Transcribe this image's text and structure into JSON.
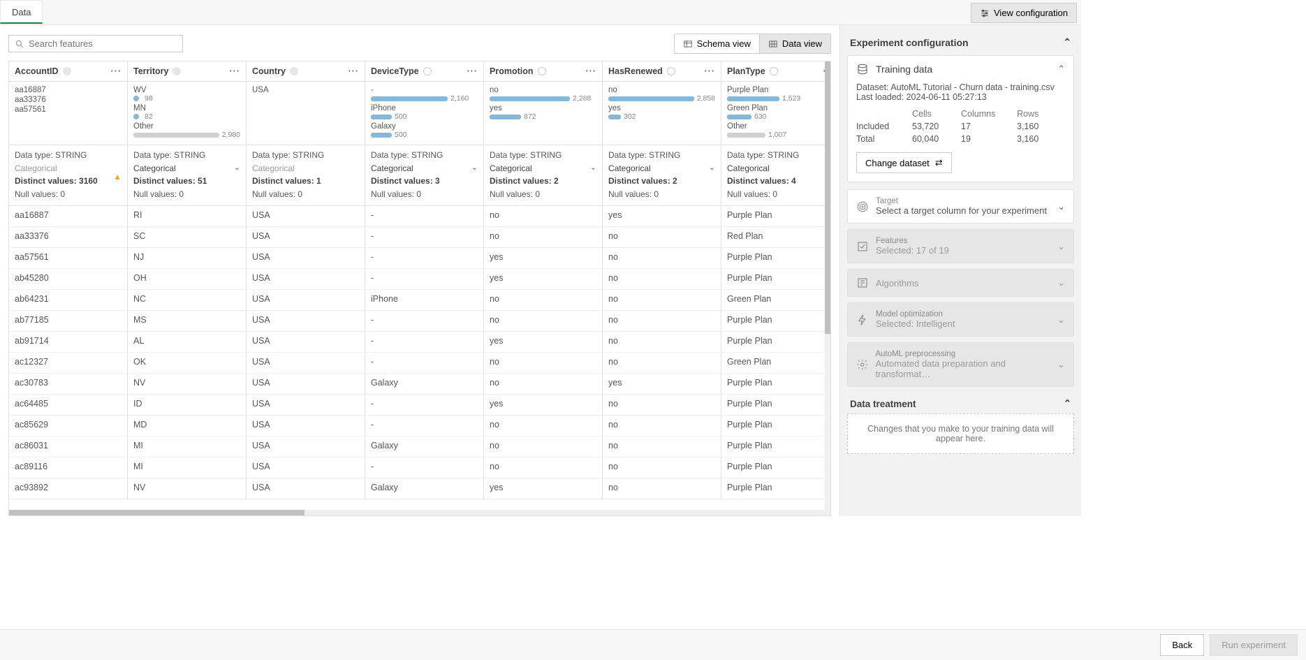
{
  "topbar": {
    "tab_label": "Data",
    "view_config_label": "View configuration"
  },
  "toolbar": {
    "search_placeholder": "Search features",
    "schema_view_label": "Schema view",
    "data_view_label": "Data view"
  },
  "columns": [
    {
      "name": "AccountID",
      "indicator": "dot",
      "data_type": "Data type: STRING",
      "treatment": "Categorical",
      "treatment_active": false,
      "distinct": "Distinct values: 3160",
      "nulls": "Null values: 0",
      "warn": true,
      "distro": [
        {
          "label": "aa16887"
        },
        {
          "label": "aa33376"
        },
        {
          "label": "aa57561"
        }
      ]
    },
    {
      "name": "Territory",
      "indicator": "dot",
      "data_type": "Data type: STRING",
      "treatment": "Categorical",
      "treatment_active": true,
      "distinct": "Distinct values: 51",
      "nulls": "Null values: 0",
      "distro": [
        {
          "label": "WV",
          "num": "98",
          "dot": true
        },
        {
          "label": "MN",
          "num": "82",
          "dot": true
        },
        {
          "label": "Other",
          "bar": 140,
          "num": "2,980",
          "gray": true
        }
      ]
    },
    {
      "name": "Country",
      "indicator": "dot",
      "data_type": "Data type: STRING",
      "treatment": "Categorical",
      "treatment_active": false,
      "distinct": "Distinct values: 1",
      "nulls": "Null values: 0",
      "distro": [
        {
          "label": "USA"
        }
      ]
    },
    {
      "name": "DeviceType",
      "indicator": "ring",
      "data_type": "Data type: STRING",
      "treatment": "Categorical",
      "treatment_active": true,
      "distinct": "Distinct values: 3",
      "nulls": "Null values: 0",
      "distro": [
        {
          "label": "-",
          "bar": 110,
          "num": "2,160"
        },
        {
          "label": "iPhone",
          "bar": 30,
          "num": "500"
        },
        {
          "label": "Galaxy",
          "bar": 30,
          "num": "500"
        }
      ]
    },
    {
      "name": "Promotion",
      "indicator": "ring",
      "data_type": "Data type: STRING",
      "treatment": "Categorical",
      "treatment_active": true,
      "distinct": "Distinct values: 2",
      "nulls": "Null values: 0",
      "distro": [
        {
          "label": "no",
          "bar": 115,
          "num": "2,288"
        },
        {
          "label": "yes",
          "bar": 45,
          "num": "872"
        }
      ]
    },
    {
      "name": "HasRenewed",
      "indicator": "ring",
      "data_type": "Data type: STRING",
      "treatment": "Categorical",
      "treatment_active": true,
      "distinct": "Distinct values: 2",
      "nulls": "Null values: 0",
      "distro": [
        {
          "label": "no",
          "bar": 130,
          "num": "2,858"
        },
        {
          "label": "yes",
          "bar": 18,
          "num": "302"
        }
      ]
    },
    {
      "name": "PlanType",
      "indicator": "ring",
      "data_type": "Data type: STRING",
      "treatment": "Categorical",
      "treatment_active": true,
      "distinct": "Distinct values: 4",
      "nulls": "Null values: 0",
      "distro": [
        {
          "label": "Purple Plan",
          "bar": 75,
          "num": "1,523"
        },
        {
          "label": "Green Plan",
          "bar": 35,
          "num": "630"
        },
        {
          "label": "Other",
          "bar": 55,
          "num": "1,007",
          "gray": true
        }
      ]
    }
  ],
  "rows": [
    {
      "c": [
        "aa16887",
        "RI",
        "USA",
        "-",
        "no",
        "yes",
        "Purple Plan"
      ]
    },
    {
      "c": [
        "aa33376",
        "SC",
        "USA",
        "-",
        "no",
        "no",
        "Red Plan"
      ]
    },
    {
      "c": [
        "aa57561",
        "NJ",
        "USA",
        "-",
        "yes",
        "no",
        "Purple Plan"
      ]
    },
    {
      "c": [
        "ab45280",
        "OH",
        "USA",
        "-",
        "yes",
        "no",
        "Purple Plan"
      ]
    },
    {
      "c": [
        "ab64231",
        "NC",
        "USA",
        "iPhone",
        "no",
        "no",
        "Green Plan"
      ]
    },
    {
      "c": [
        "ab77185",
        "MS",
        "USA",
        "-",
        "no",
        "no",
        "Purple Plan"
      ]
    },
    {
      "c": [
        "ab91714",
        "AL",
        "USA",
        "-",
        "yes",
        "no",
        "Purple Plan"
      ]
    },
    {
      "c": [
        "ac12327",
        "OK",
        "USA",
        "-",
        "no",
        "no",
        "Green Plan"
      ]
    },
    {
      "c": [
        "ac30783",
        "NV",
        "USA",
        "Galaxy",
        "no",
        "yes",
        "Purple Plan"
      ]
    },
    {
      "c": [
        "ac64485",
        "ID",
        "USA",
        "-",
        "yes",
        "no",
        "Purple Plan"
      ]
    },
    {
      "c": [
        "ac85629",
        "MD",
        "USA",
        "-",
        "no",
        "no",
        "Purple Plan"
      ]
    },
    {
      "c": [
        "ac86031",
        "MI",
        "USA",
        "Galaxy",
        "no",
        "no",
        "Purple Plan"
      ]
    },
    {
      "c": [
        "ac89116",
        "MI",
        "USA",
        "-",
        "no",
        "no",
        "Purple Plan"
      ]
    },
    {
      "c": [
        "ac93892",
        "NV",
        "USA",
        "Galaxy",
        "yes",
        "no",
        "Purple Plan"
      ]
    }
  ],
  "config": {
    "panel_title": "Experiment configuration",
    "training_data_title": "Training data",
    "dataset_label": "Dataset: AutoML Tutorial - Churn data - training.csv",
    "last_loaded_label": "Last loaded: 2024-06-11 05:27:13",
    "stats": {
      "cells_hd": "Cells",
      "columns_hd": "Columns",
      "rows_hd": "Rows",
      "included_label": "Included",
      "total_label": "Total",
      "inc_cells": "53,720",
      "inc_cols": "17",
      "inc_rows": "3,160",
      "tot_cells": "60,040",
      "tot_cols": "19",
      "tot_rows": "3,160"
    },
    "change_dataset_label": "Change dataset",
    "target_title": "Target",
    "target_sub": "Select a target column for your experiment",
    "features_title": "Features",
    "features_sub": "Selected: 17 of 19",
    "algorithms_title": "Algorithms",
    "modelopt_title": "Model optimization",
    "modelopt_sub": "Selected: Intelligent",
    "automl_title": "AutoML preprocessing",
    "automl_sub": "Automated data preparation and transformat…",
    "data_treatment_title": "Data treatment",
    "data_treatment_msg": "Changes that you make to your training data will appear here."
  },
  "footer": {
    "back_label": "Back",
    "run_label": "Run experiment"
  }
}
